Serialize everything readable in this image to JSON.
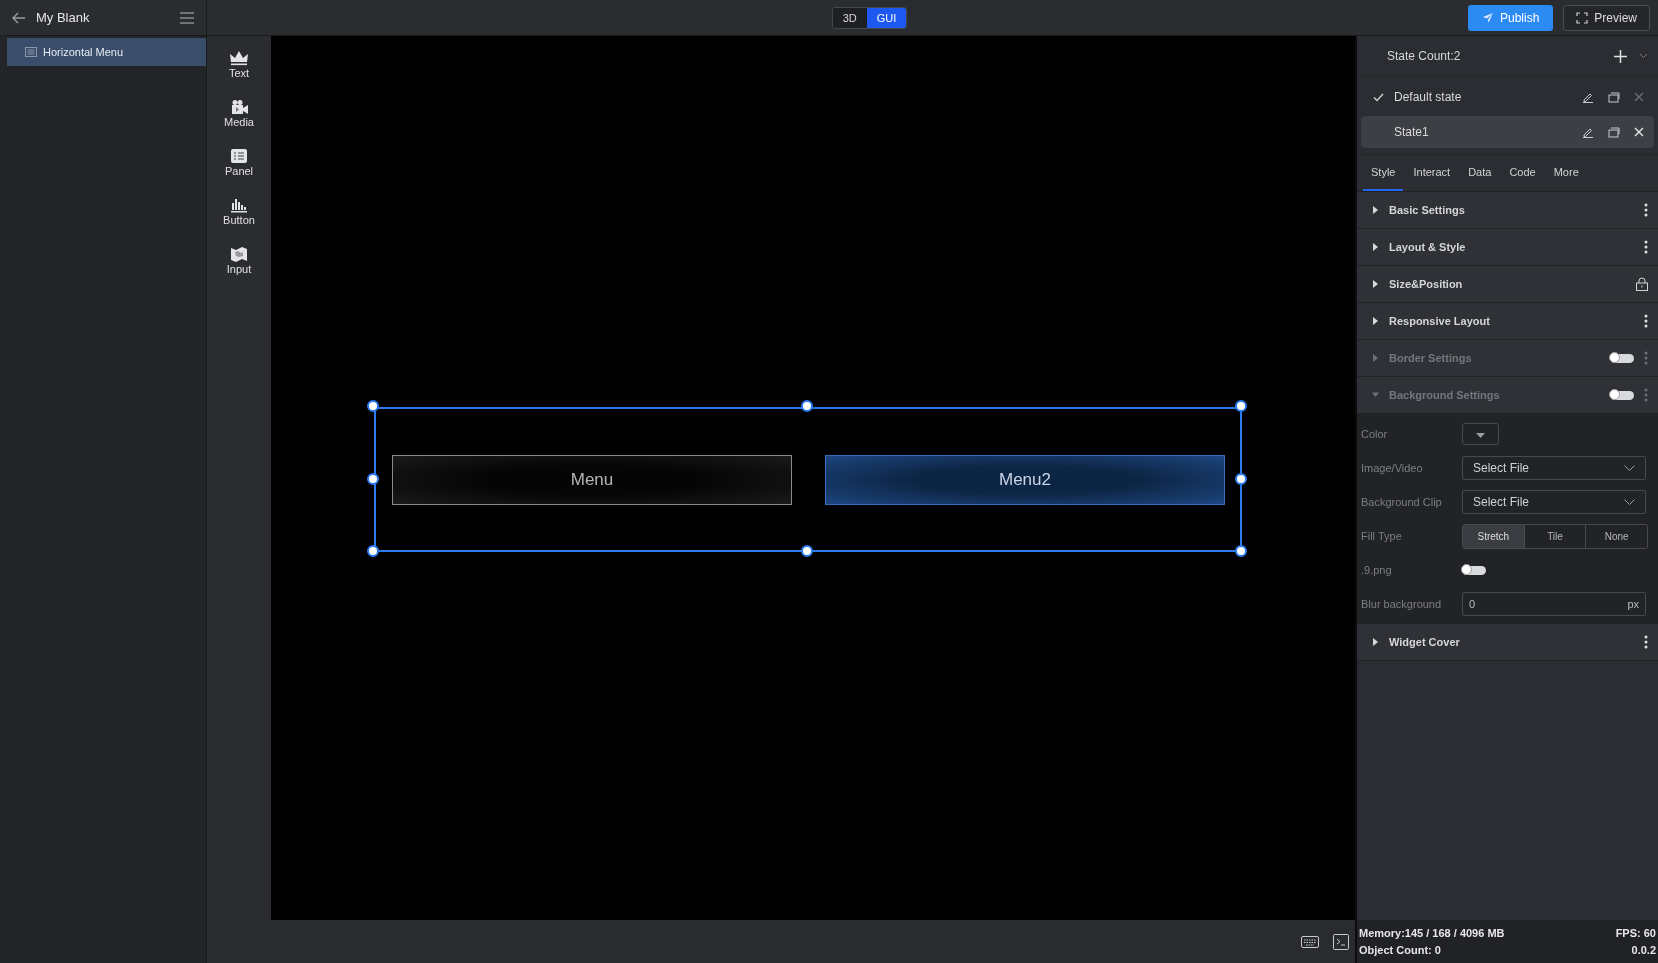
{
  "header": {
    "title": "My Blank"
  },
  "mode_toggle": [
    {
      "label": "3D",
      "selected": false
    },
    {
      "label": "GUI",
      "selected": true
    }
  ],
  "actions": {
    "publish": "Publish",
    "preview": "Preview"
  },
  "layers": [
    {
      "label": "Horizontal Menu",
      "selected": true
    }
  ],
  "toolbox": [
    {
      "label": "Text"
    },
    {
      "label": "Media"
    },
    {
      "label": "Panel"
    },
    {
      "label": "Button"
    },
    {
      "label": "Input"
    }
  ],
  "canvas": {
    "menu_items": [
      {
        "label": "Menu",
        "selected": false
      },
      {
        "label": "Menu2",
        "selected": true
      }
    ]
  },
  "states": {
    "count_label": "State Count:2",
    "items": [
      {
        "name": "Default state",
        "checked": true,
        "selected": false
      },
      {
        "name": "State1",
        "checked": false,
        "selected": true
      }
    ]
  },
  "tabs": [
    {
      "label": "Style",
      "selected": true
    },
    {
      "label": "Interact",
      "selected": false
    },
    {
      "label": "Data",
      "selected": false
    },
    {
      "label": "Code",
      "selected": false
    },
    {
      "label": "More",
      "selected": false
    }
  ],
  "sections": [
    {
      "title": "Basic Settings",
      "kind": "menu",
      "expanded": false,
      "disabled": false
    },
    {
      "title": "Layout & Style",
      "kind": "menu",
      "expanded": false,
      "disabled": false
    },
    {
      "title": "Size&Position",
      "kind": "lock",
      "expanded": false,
      "disabled": false
    },
    {
      "title": "Responsive Layout",
      "kind": "menu",
      "expanded": false,
      "disabled": false
    },
    {
      "title": "Border Settings",
      "kind": "toggle",
      "on": false,
      "expanded": false,
      "disabled": true
    },
    {
      "title": "Background Settings",
      "kind": "toggle",
      "on": false,
      "expanded": true,
      "disabled": true,
      "fields": [
        {
          "kind": "color",
          "label": "Color"
        },
        {
          "kind": "select",
          "label": "Image/Video",
          "value": "Select File"
        },
        {
          "kind": "select",
          "label": "Background Clip",
          "value": "Select File"
        },
        {
          "kind": "segmented",
          "label": "Fill Type",
          "options": [
            {
              "label": "Stretch",
              "selected": true
            },
            {
              "label": "Tile",
              "selected": false
            },
            {
              "label": "None",
              "selected": false
            }
          ]
        },
        {
          "kind": "toggle",
          "label": ".9.png",
          "on": false
        },
        {
          "kind": "number",
          "label": "Blur background",
          "value": "0",
          "unit": "px"
        }
      ]
    },
    {
      "title": "Widget Cover",
      "kind": "menu",
      "expanded": false,
      "disabled": false
    }
  ],
  "status": {
    "memory": "Memory:145 / 168 / 4096 MB",
    "fps": "FPS: 60",
    "objects": "Object Count: 0",
    "version": "0.0.2"
  }
}
